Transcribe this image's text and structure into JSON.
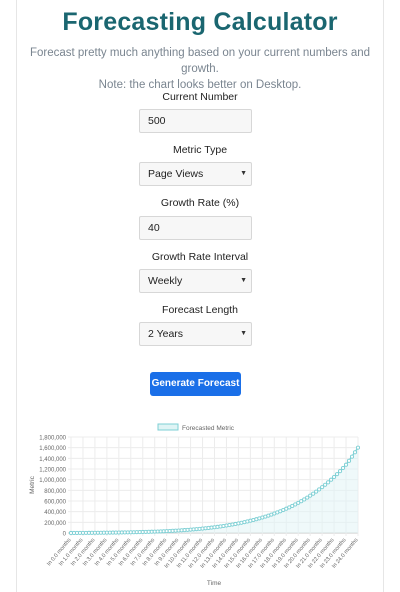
{
  "header": {
    "title": "Forecasting Calculator",
    "subtitle_line1": "Forecast pretty much anything based on your current numbers and growth.",
    "subtitle_line2": "Note: the chart looks better on Desktop."
  },
  "form": {
    "current_number": {
      "label": "Current Number",
      "value": "500"
    },
    "metric_type": {
      "label": "Metric Type",
      "value": "Page Views"
    },
    "growth_rate": {
      "label": "Growth Rate (%)",
      "value": "40"
    },
    "growth_interval": {
      "label": "Growth Rate Interval",
      "value": "Weekly"
    },
    "forecast_length": {
      "label": "Forecast Length",
      "value": "2 Years"
    },
    "submit_label": "Generate Forecast"
  },
  "icons": {
    "select_caret": "caret-down-icon"
  },
  "colors": {
    "title": "#1a6670",
    "button": "#1a6fe8",
    "series_line": "#7dcfd4",
    "series_fill": "#dff4f5"
  },
  "chart_data": {
    "type": "line",
    "legend": [
      "Forecasted Metric"
    ],
    "legend_position": "top-center",
    "xlabel": "Time",
    "ylabel": "Metric",
    "ylim": [
      0,
      1800000
    ],
    "yticks": [
      "0",
      "200,000",
      "400,000",
      "600,000",
      "800,000",
      "1,000,000",
      "1,200,000",
      "1,400,000",
      "1,600,000",
      "1,800,000"
    ],
    "grid": true,
    "x": [
      "In 0.0 months",
      "In 1.0 months",
      "In 2.0 months",
      "In 3.0 months",
      "In 4.0 months",
      "In 5.0 months",
      "In 6.0 months",
      "In 7.0 months",
      "In 8.0 months",
      "In 9.0 months",
      "In 10.0 months",
      "In 11.0 months",
      "In 12.0 months",
      "In 13.0 months",
      "In 14.0 months",
      "In 15.0 months",
      "In 16.0 months",
      "In 17.0 months",
      "In 18.0 months",
      "In 19.0 months",
      "In 20.0 months",
      "In 21.0 months",
      "In 22.0 months",
      "In 23.0 months",
      "In 24.0 months"
    ],
    "series": [
      {
        "name": "Forecasted Metric",
        "values": [
          500,
          2000,
          4000,
          6000,
          9000,
          13000,
          19000,
          26000,
          35000,
          47000,
          63000,
          83000,
          108000,
          140000,
          180000,
          230000,
          290000,
          365000,
          455000,
          565000,
          700000,
          860000,
          1050000,
          1280000,
          1600000
        ]
      }
    ]
  }
}
